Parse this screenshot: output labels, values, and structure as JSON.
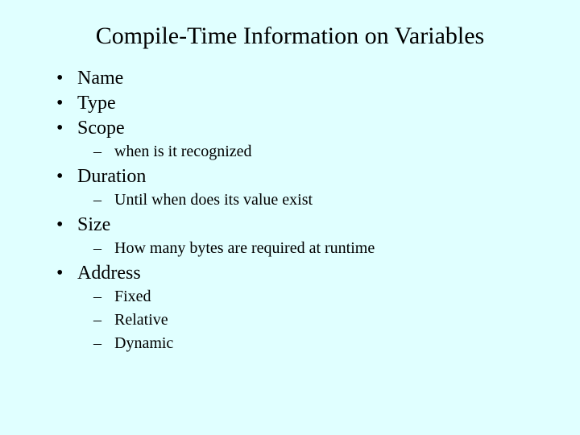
{
  "title": "Compile-Time Information on Variables",
  "items": {
    "i0": {
      "label": "Name"
    },
    "i1": {
      "label": "Type"
    },
    "i2": {
      "label": "Scope",
      "sub": {
        "s0": "when is it recognized"
      }
    },
    "i3": {
      "label": "Duration",
      "sub": {
        "s0": "Until when does its value exist"
      }
    },
    "i4": {
      "label": "Size",
      "sub": {
        "s0": "How many bytes are required at runtime"
      }
    },
    "i5": {
      "label": "Address",
      "sub": {
        "s0": "Fixed",
        "s1": "Relative",
        "s2": "Dynamic"
      }
    }
  },
  "glyphs": {
    "b1": "•",
    "b2": "–"
  }
}
